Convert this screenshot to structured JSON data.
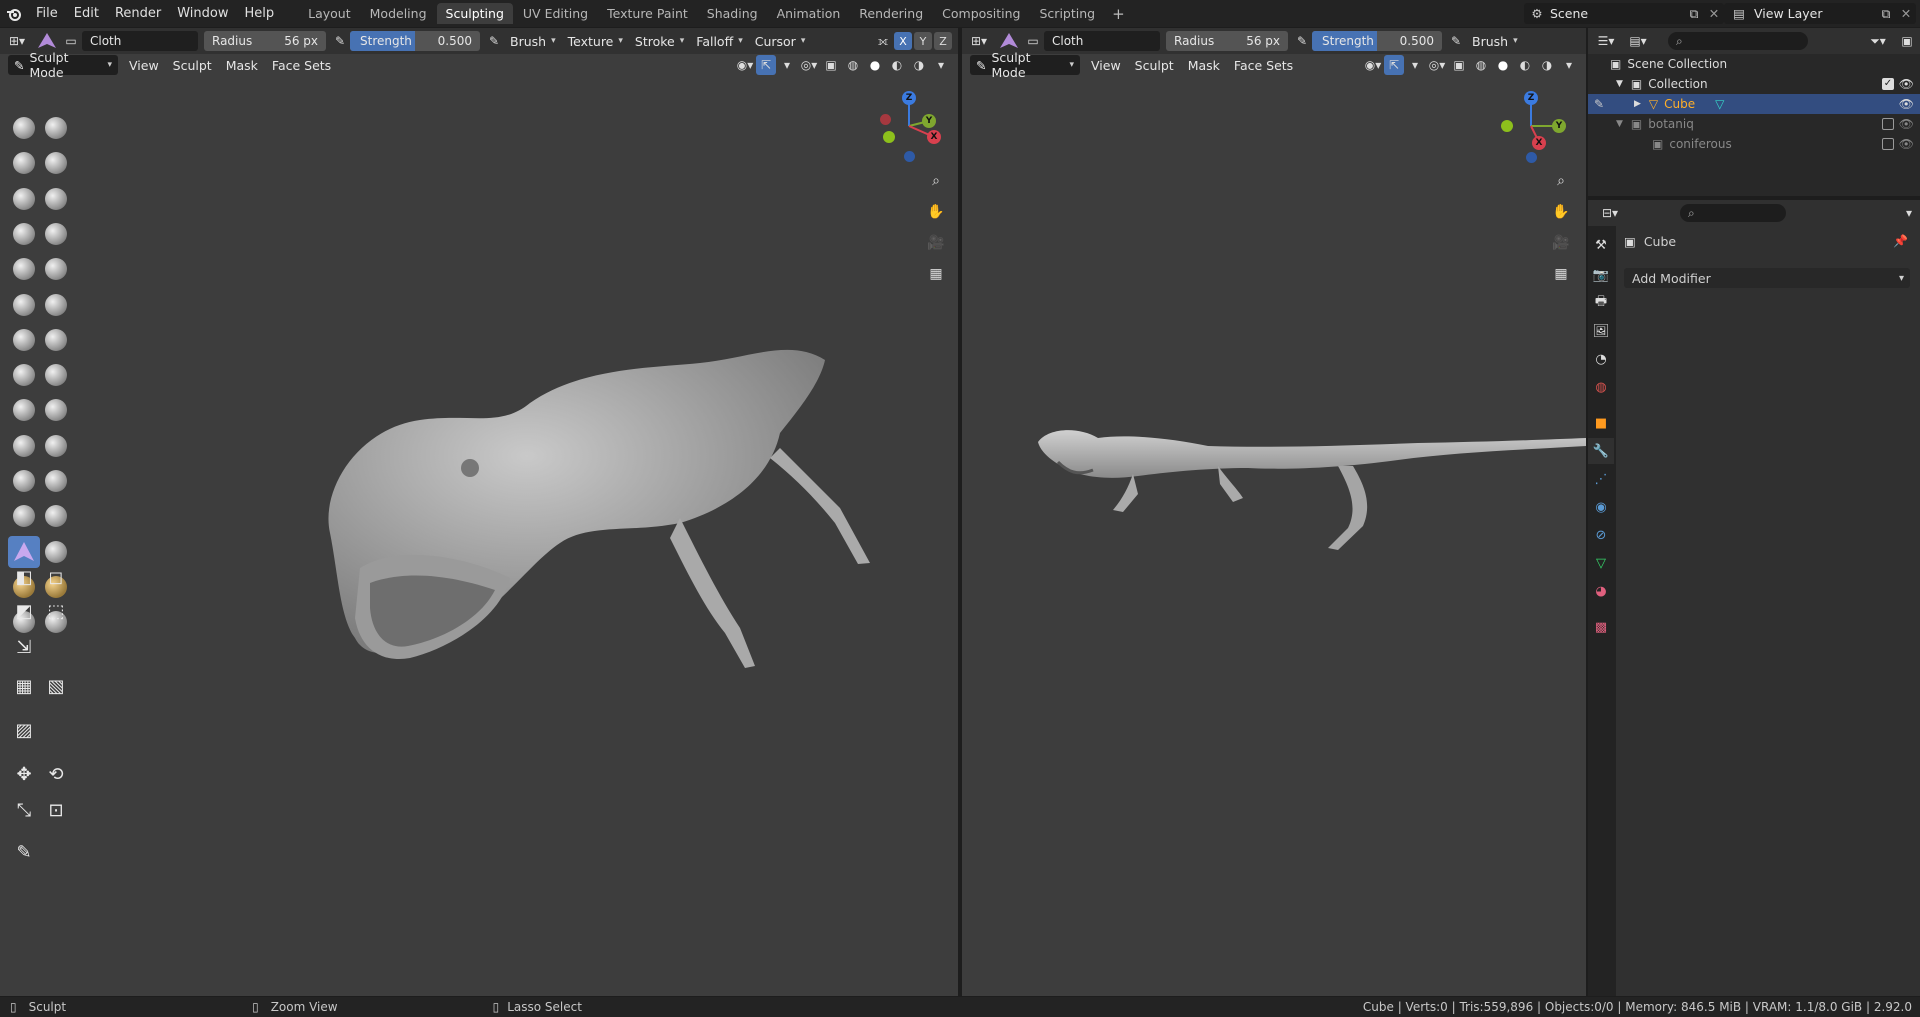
{
  "app": {
    "logo_icon": "blender-logo-icon"
  },
  "menu": [
    "File",
    "Edit",
    "Render",
    "Window",
    "Help"
  ],
  "workspaces": [
    "Layout",
    "Modeling",
    "Sculpting",
    "UV Editing",
    "Texture Paint",
    "Shading",
    "Animation",
    "Rendering",
    "Compositing",
    "Scripting"
  ],
  "active_workspace": "Sculpting",
  "scene": {
    "name": "Scene",
    "view_layer": "View Layer"
  },
  "left_view": {
    "brush_name": "Cloth",
    "radius_label": "Radius",
    "radius_value": "56 px",
    "strength_label": "Strength",
    "strength_value": "0.500",
    "strength_fraction": 0.5,
    "menus": [
      "Brush",
      "Texture",
      "Stroke",
      "Falloff",
      "Cursor"
    ],
    "axes": [
      "X",
      "Y",
      "Z"
    ],
    "mode": "Sculpt Mode",
    "view_menus": [
      "View",
      "Sculpt",
      "Mask",
      "Face Sets"
    ]
  },
  "right_view": {
    "brush_name": "Cloth",
    "radius_label": "Radius",
    "radius_value": "56 px",
    "strength_label": "Strength",
    "strength_value": "0.500",
    "strength_fraction": 0.5,
    "menus": [
      "Brush"
    ],
    "mode": "Sculpt Mode",
    "view_menus": [
      "View",
      "Sculpt",
      "Mask",
      "Face Sets"
    ]
  },
  "gizmo": {
    "z": "Z",
    "y": "Y",
    "x": "X"
  },
  "outliner": {
    "root": "Scene Collection",
    "items": [
      {
        "label": "Collection",
        "level": 1
      },
      {
        "label": "Cube",
        "level": 2,
        "selected": true
      },
      {
        "label": "botaniq",
        "level": 1
      },
      {
        "label": "coniferous",
        "level": 2
      }
    ]
  },
  "properties": {
    "object_name": "Cube",
    "add_modifier": "Add Modifier"
  },
  "status": {
    "left": "Sculpt",
    "middle": "Zoom View",
    "right_action": "Lasso Select",
    "stats": "Cube | Verts:0 | Tris:559,896 | Objects:0/0 | Memory: 846.5 MiB | VRAM: 1.1/8.0 GiB | 2.92.0"
  },
  "colors": {
    "accent": "#4772b3",
    "active_tool": "#5680c2",
    "viewport_bg": "#3d3d3d",
    "selected_row": "#334d80",
    "cube_text": "#ffaf29"
  }
}
